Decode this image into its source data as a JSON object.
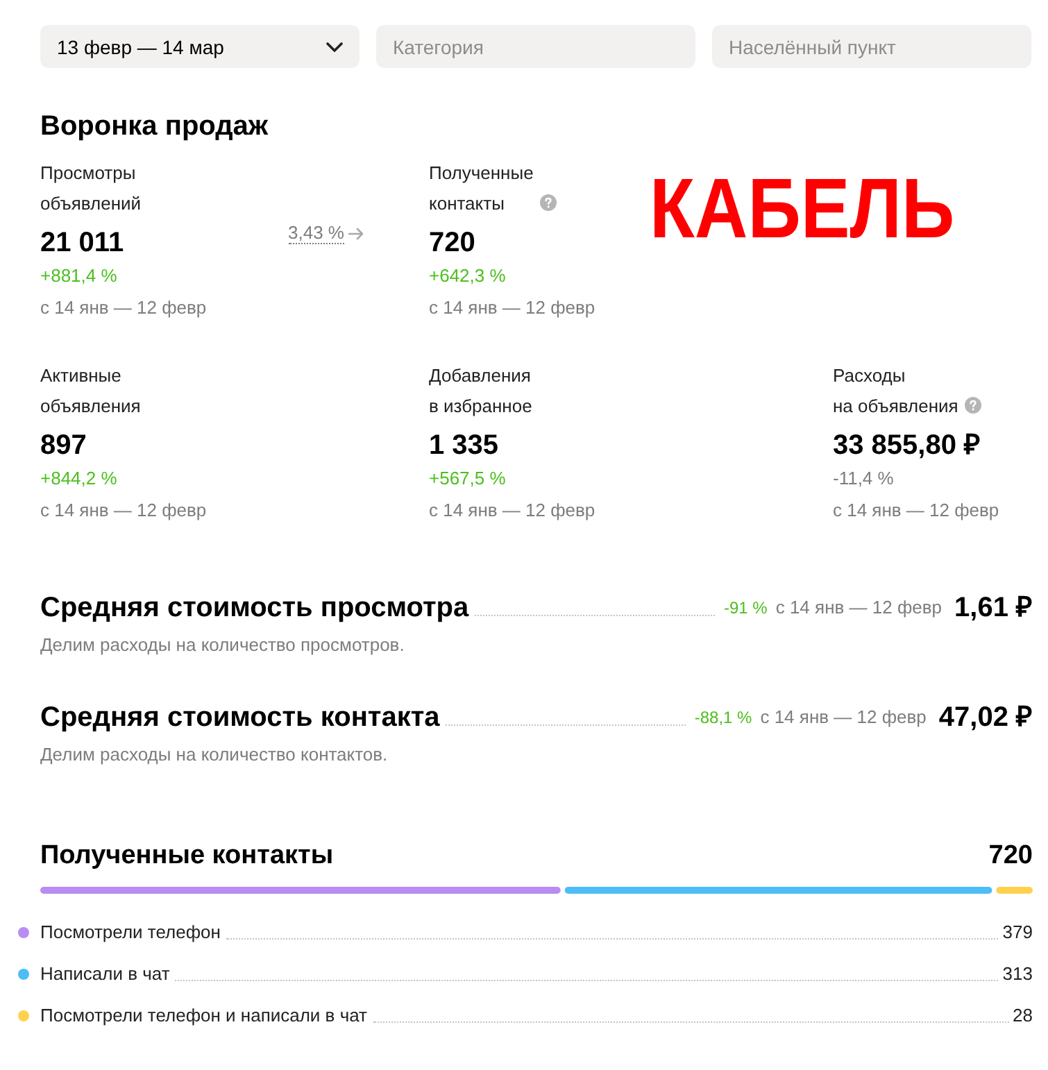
{
  "filters": [
    {
      "kind": "dropdown",
      "value": "13 февр — 14 мар"
    },
    {
      "kind": "input",
      "placeholder": "Категория"
    },
    {
      "kind": "input",
      "placeholder": "Населённый пункт"
    }
  ],
  "funnel": {
    "title": "Воронка продаж",
    "overlay_label": "КАБЕЛЬ",
    "rows": [
      {
        "metrics": [
          {
            "label": "Просмотры\nобъявлений",
            "help": false,
            "value": "21 011",
            "change": "+881,4 %",
            "change_positive": true,
            "period": "с 14 янв — 12 февр",
            "conversion_to_next": "3,43 %"
          },
          {
            "label": "Полученные\nконтакты",
            "help": true,
            "value": "720",
            "change": "+642,3 %",
            "change_positive": true,
            "period": "с 14 янв — 12 февр"
          }
        ]
      },
      {
        "metrics": [
          {
            "label": "Активные\nобъявления",
            "help": false,
            "value": "897",
            "change": "+844,2 %",
            "change_positive": true,
            "period": "с 14 янв — 12 февр"
          },
          {
            "label": "Добавления\nв избранное",
            "help": false,
            "value": "1 335",
            "change": "+567,5 %",
            "change_positive": true,
            "period": "с 14 янв — 12 февр"
          },
          {
            "label": "Расходы\nна объявления",
            "help": true,
            "value": "33 855,80 ₽",
            "change": "-11,4 %",
            "change_positive": false,
            "period": "с 14 янв — 12 февр"
          }
        ]
      }
    ]
  },
  "cost_metrics": [
    {
      "title": "Средняя стоимость просмотра",
      "change": "-91 %",
      "change_positive": true,
      "period": "с 14 янв — 12 февр",
      "value": "1,61 ₽",
      "description": "Делим расходы на количество просмотров."
    },
    {
      "title": "Средняя стоимость контакта",
      "change": "-88,1 %",
      "change_positive": true,
      "period": "с 14 янв — 12 февр",
      "value": "47,02 ₽",
      "description": "Делим расходы на количество контактов."
    }
  ],
  "contacts": {
    "title": "Полученные контакты",
    "total": "720",
    "items": [
      {
        "label": "Посмотрели телефон",
        "value": "379",
        "color": "#b98cf2"
      },
      {
        "label": "Написали в чат",
        "value": "313",
        "color": "#4dbdf7"
      },
      {
        "label": "Посмотрели телефон и написали в чат",
        "value": "28",
        "color": "#ffd24d"
      }
    ]
  }
}
